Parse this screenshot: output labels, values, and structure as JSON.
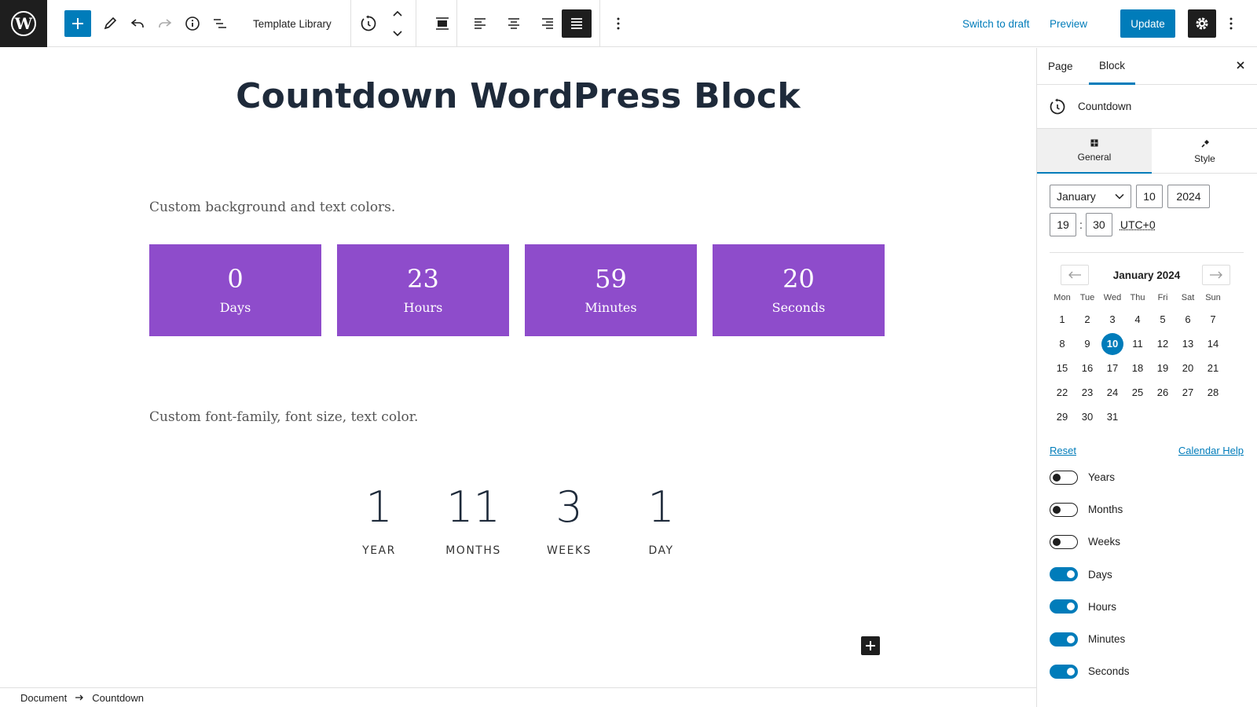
{
  "toolbar": {
    "template_library": "Template Library",
    "switch_to_draft": "Switch to draft",
    "preview": "Preview",
    "update": "Update"
  },
  "content": {
    "title": "Countdown WordPress Block",
    "desc1": "Custom background and text colors.",
    "desc2": "Custom font-family, font size, text color.",
    "countdown1": [
      {
        "value": "0",
        "label": "Days"
      },
      {
        "value": "23",
        "label": "Hours"
      },
      {
        "value": "59",
        "label": "Minutes"
      },
      {
        "value": "20",
        "label": "Seconds"
      }
    ],
    "countdown2": [
      {
        "value": "1",
        "label": "YEAR"
      },
      {
        "value": "11",
        "label": "MONTHS"
      },
      {
        "value": "3",
        "label": "WEEKS"
      },
      {
        "value": "1",
        "label": "DAY"
      }
    ],
    "countdown1_color": "#8e4ccb"
  },
  "footer": {
    "crumbs": [
      "Document",
      "Countdown"
    ]
  },
  "sidebar": {
    "tab_page": "Page",
    "tab_block": "Block",
    "block_name": "Countdown",
    "subtab_general": "General",
    "subtab_style": "Style",
    "date": {
      "month": "January",
      "day": "10",
      "year": "2024",
      "hour": "19",
      "minute": "30",
      "timezone": "UTC+0"
    },
    "calendar": {
      "title": "January 2024",
      "weekdays": [
        "Mon",
        "Tue",
        "Wed",
        "Thu",
        "Fri",
        "Sat",
        "Sun"
      ],
      "weeks": [
        [
          "1",
          "2",
          "3",
          "4",
          "5",
          "6",
          "7"
        ],
        [
          "8",
          "9",
          "10",
          "11",
          "12",
          "13",
          "14"
        ],
        [
          "15",
          "16",
          "17",
          "18",
          "19",
          "20",
          "21"
        ],
        [
          "22",
          "23",
          "24",
          "25",
          "26",
          "27",
          "28"
        ],
        [
          "29",
          "30",
          "31",
          "",
          "",
          "",
          ""
        ]
      ],
      "selected": "10",
      "reset": "Reset",
      "help": "Calendar Help"
    },
    "toggles": [
      {
        "label": "Years",
        "on": false
      },
      {
        "label": "Months",
        "on": false
      },
      {
        "label": "Weeks",
        "on": false
      },
      {
        "label": "Days",
        "on": true
      },
      {
        "label": "Hours",
        "on": true
      },
      {
        "label": "Minutes",
        "on": true
      },
      {
        "label": "Seconds",
        "on": true
      }
    ]
  },
  "colors": {
    "accent": "#007cba",
    "dark": "#1e1e1e"
  }
}
